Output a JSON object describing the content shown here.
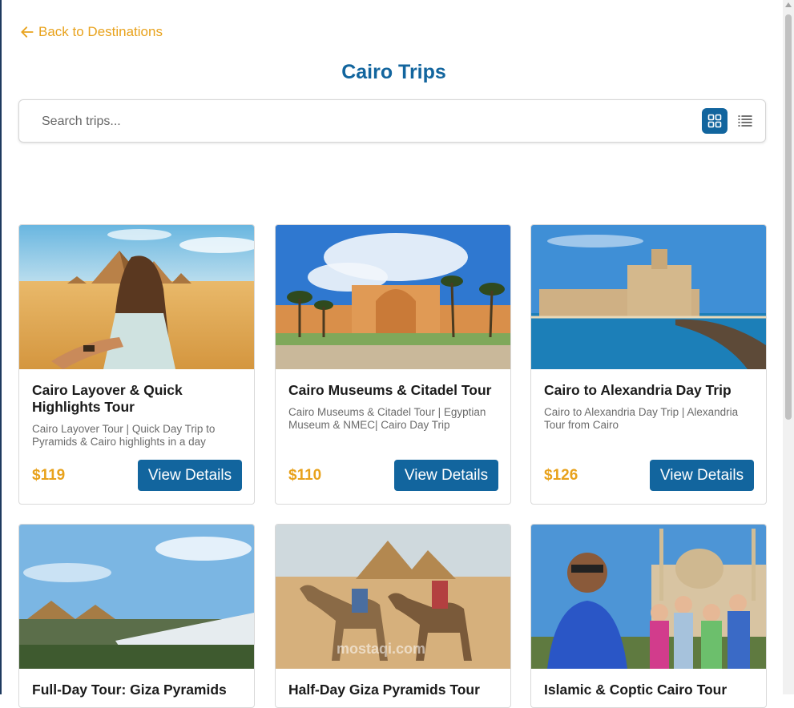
{
  "nav": {
    "back_label": "Back to Destinations"
  },
  "page": {
    "title": "Cairo Trips"
  },
  "search": {
    "placeholder": "Search trips..."
  },
  "colors": {
    "primary": "#12659e",
    "accent": "#e8a21c"
  },
  "icons": {
    "back": "arrow-left-icon",
    "grid": "grid-view-icon",
    "list": "list-view-icon"
  },
  "trips": [
    {
      "title": "Cairo Layover & Quick Highlights Tour",
      "description": "Cairo Layover Tour | Quick Day Trip to Pyramids & Cairo highlights in a day",
      "price": "$119",
      "button": "View Details"
    },
    {
      "title": "Cairo Museums & Citadel Tour",
      "description": "Cairo Museums & Citadel Tour | Egyptian Museum & NMEC| Cairo Day Trip",
      "price": "$110",
      "button": "View Details"
    },
    {
      "title": "Cairo to Alexandria Day Trip",
      "description": "Cairo to Alexandria Day Trip | Alexandria Tour from Cairo",
      "price": "$126",
      "button": "View Details"
    },
    {
      "title": "Full-Day Tour: Giza Pyramids"
    },
    {
      "title": "Half-Day Giza Pyramids Tour"
    },
    {
      "title": "Islamic & Coptic Cairo Tour"
    }
  ],
  "watermark": "mostaqi.com"
}
